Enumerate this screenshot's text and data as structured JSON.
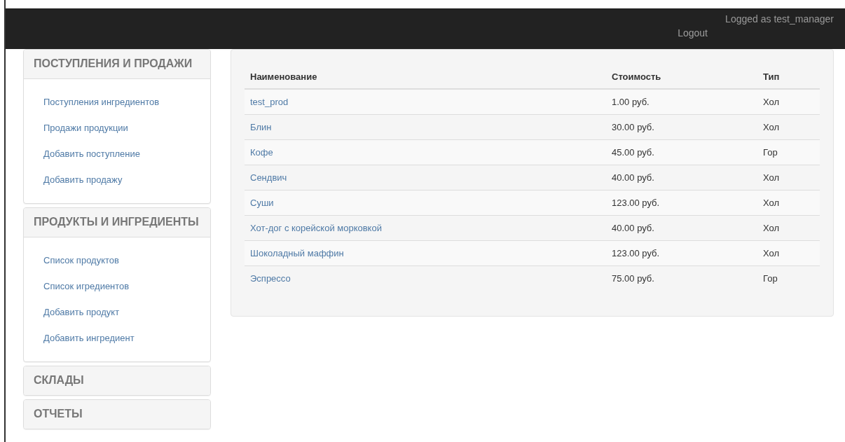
{
  "navbar": {
    "user": "Logged as test_manager",
    "logout": "Logout"
  },
  "sidebar": [
    {
      "title": "ПОСТУПЛЕНИЯ И ПРОДАЖИ",
      "expanded": true,
      "items": [
        "Поступления ингредиентов",
        "Продажи продукции",
        "Добавить поступление",
        "Добавить продажу"
      ]
    },
    {
      "title": "ПРОДУКТЫ И ИНГРЕДИЕНТЫ",
      "expanded": true,
      "items": [
        "Список продуктов",
        "Список игредиентов",
        "Добавить продукт",
        "Добавить ингредиент"
      ]
    },
    {
      "title": "СКЛАДЫ",
      "expanded": false
    },
    {
      "title": "ОТЧЕТЫ",
      "expanded": false
    }
  ],
  "table": {
    "columns": [
      "Наименование",
      "Стоимость",
      "Тип"
    ],
    "rows": [
      [
        "test_prod",
        "1.00 руб.",
        "Хол"
      ],
      [
        "Блин",
        "30.00 руб.",
        "Хол"
      ],
      [
        "Кофе",
        "45.00 руб.",
        "Гор"
      ],
      [
        "Сендвич",
        "40.00 руб.",
        "Хол"
      ],
      [
        "Суши",
        "123.00 руб.",
        "Хол"
      ],
      [
        "Хот-дог с корейской морковкой",
        "40.00 руб.",
        "Хол"
      ],
      [
        "Шоколадный маффин",
        "123.00 руб.",
        "Хол"
      ],
      [
        "Эспрессо",
        "75.00 руб.",
        "Гор"
      ]
    ]
  }
}
